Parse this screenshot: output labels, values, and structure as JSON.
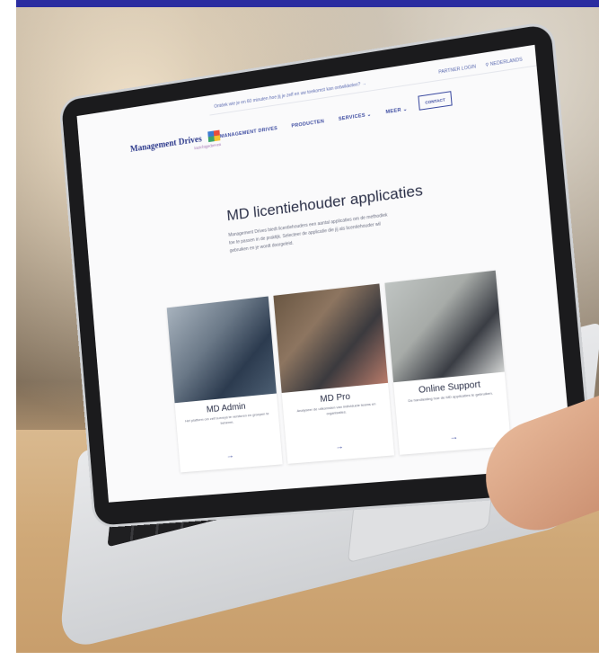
{
  "site": {
    "utility": {
      "notice": "Ontdek wie je en 60 minuten hoe jij je zelf en uw toekomst kan ontwikkelen? →",
      "partner_login": "PARTNER LOGIN",
      "language": "NEDERLANDS"
    },
    "logo": {
      "name": "Management Drives",
      "tagline": "inzichtgedreven"
    },
    "nav": [
      "MANAGEMENT DRIVES",
      "PRODUCTEN",
      "SERVICES ⌄",
      "MEER ⌄"
    ],
    "contact_label": "CONTACT",
    "hero": {
      "title": "MD licentiehouder applicaties",
      "description": "Management Drives biedt licentiehouders een aantal applicaties om de methodiek toe te passen in de praktijk. Selecteer de applicatie die jij als licentiehouder wil gebruiken en je wordt doorgeleid."
    },
    "cards": [
      {
        "title": "MD Admin",
        "description": "Het platform om zelf surveys te versturen en groepen te beheren.",
        "arrow": "→"
      },
      {
        "title": "MD Pro",
        "description": "Analyseer de uitkomsten van individuele teams en organisaties.",
        "arrow": "→"
      },
      {
        "title": "Online Support",
        "description": "De handleiding hoe de MD applicaties te gebruiken.",
        "arrow": "→"
      }
    ]
  },
  "colors": {
    "brand_blue": "#2a2ca0",
    "link_blue": "#3b4aa0"
  }
}
